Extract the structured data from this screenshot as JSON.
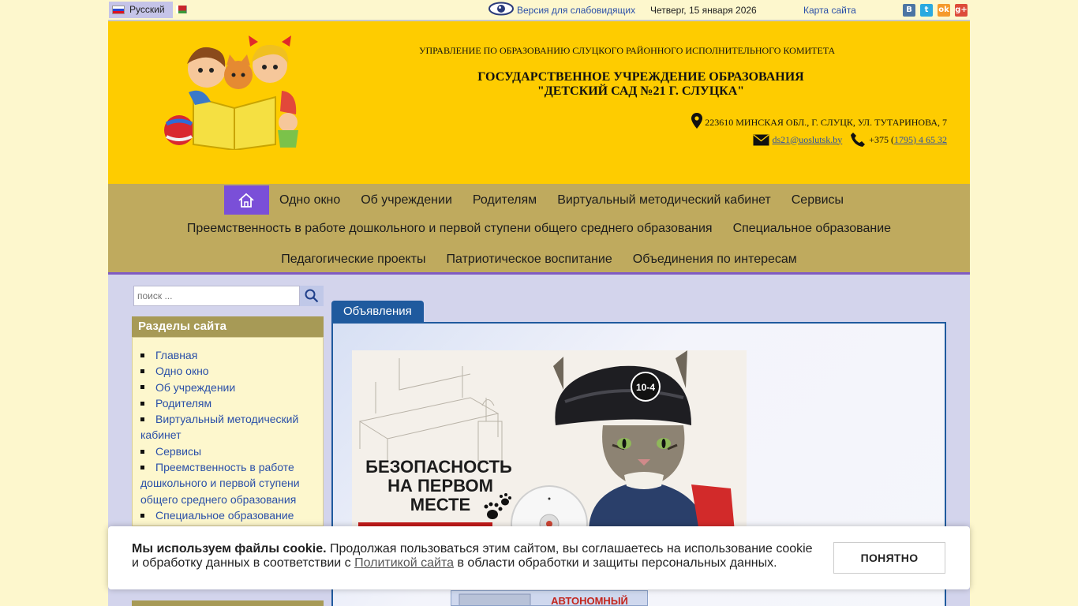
{
  "topbar": {
    "language": "Русский",
    "vision_link": "Версия для слабовидящих",
    "date": "Четверг, 15 января 2026",
    "sitemap": "Карта сайта",
    "social": [
      "В",
      "t",
      "ok",
      "g+"
    ]
  },
  "header": {
    "org_top": "УПРАВЛЕНИЕ ПО ОБРАЗОВАНИЮ СЛУЦКОГО РАЙОННОГО ИСПОЛНИТЕЛЬНОГО КОМИТЕТА",
    "title_line1": "ГОСУДАРСТВЕННОЕ УЧРЕЖДЕНИЕ ОБРАЗОВАНИЯ",
    "title_line2": "\"ДЕТСКИЙ САД №21 Г. СЛУЦКА\"",
    "address": "223610 МИНСКАЯ ОБЛ., Г. СЛУЦК, УЛ. ТУТАРИНОВА, 7",
    "email": "ds21@uoslutsk.by",
    "phone_prefix": "+375 (",
    "phone_link": "1795) 4 65 32"
  },
  "nav": {
    "row1": [
      "Одно окно",
      "Об учреждении",
      "Родителям",
      "Виртуальный методический кабинет",
      "Сервисы"
    ],
    "row2": [
      "Преемственность в работе дошкольного и первой ступени общего среднего образования",
      "Специальное образование"
    ],
    "row3": [
      "Педагогические проекты",
      "Патриотическое воспитание",
      "Объединения по интересам"
    ]
  },
  "sidebar": {
    "search_placeholder": "поиск ...",
    "sections_title": "Разделы сайта",
    "items": [
      "Главная",
      "Одно окно",
      "Об учреждении",
      "Родителям",
      "Виртуальный методический кабинет",
      "Сервисы",
      "Преемственность в работе дошкольного и первой ступени общего среднего образования",
      "Специальное образование"
    ]
  },
  "main": {
    "tab": "Объявления",
    "poster_text": [
      "БЕЗОПАСНОСТЬ",
      "НА ПЕРВОМ",
      "МЕСТЕ"
    ],
    "poster_badge": "10-4",
    "poster2_text": "АВТОНОМНЫЙ"
  },
  "cookie": {
    "bold": "Мы используем файлы cookie.",
    "text1": " Продолжая пользоваться этим сайтом, вы соглашаетесь на использование cookie и обработку данных в соответствии с ",
    "link": "Политикой сайта",
    "text2": " в области обработки и защиты персональных данных.",
    "button": "ПОНЯТНО"
  },
  "colors": {
    "header_bg": "#fecc00",
    "nav_bg": "#bfaa5e",
    "home_accent": "#7a4fd8",
    "tab_blue": "#1f5a9e",
    "page_bg": "#fdf7cd"
  }
}
